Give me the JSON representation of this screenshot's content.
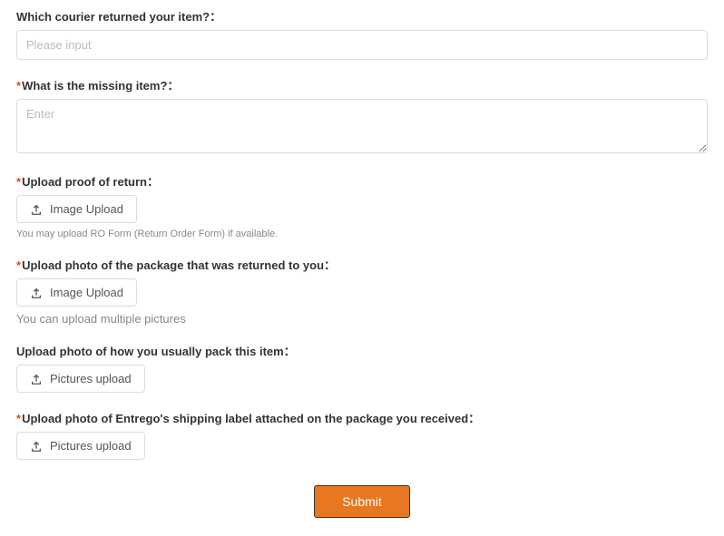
{
  "fields": {
    "courier": {
      "label": "Which courier returned your item?：",
      "placeholder": "Please input",
      "required": false
    },
    "missing_item": {
      "label": "What is the missing item?：",
      "placeholder": "Enter",
      "required": true
    },
    "proof_of_return": {
      "label": "Upload proof of return：",
      "button": "Image Upload",
      "helper": "You may upload RO Form (Return Order Form) if available.",
      "required": true
    },
    "package_photo": {
      "label": "Upload photo of the package that was returned to you：",
      "button": "Image Upload",
      "helper": "You can upload multiple pictures",
      "required": true
    },
    "packing_photo": {
      "label": "Upload photo of how you usually pack this item：",
      "button": "Pictures upload",
      "required": false
    },
    "shipping_label_photo": {
      "label": "Upload photo of Entrego's shipping label attached on the package you received：",
      "button": "Pictures upload",
      "required": true
    }
  },
  "submit_label": "Submit",
  "required_marker": "*"
}
